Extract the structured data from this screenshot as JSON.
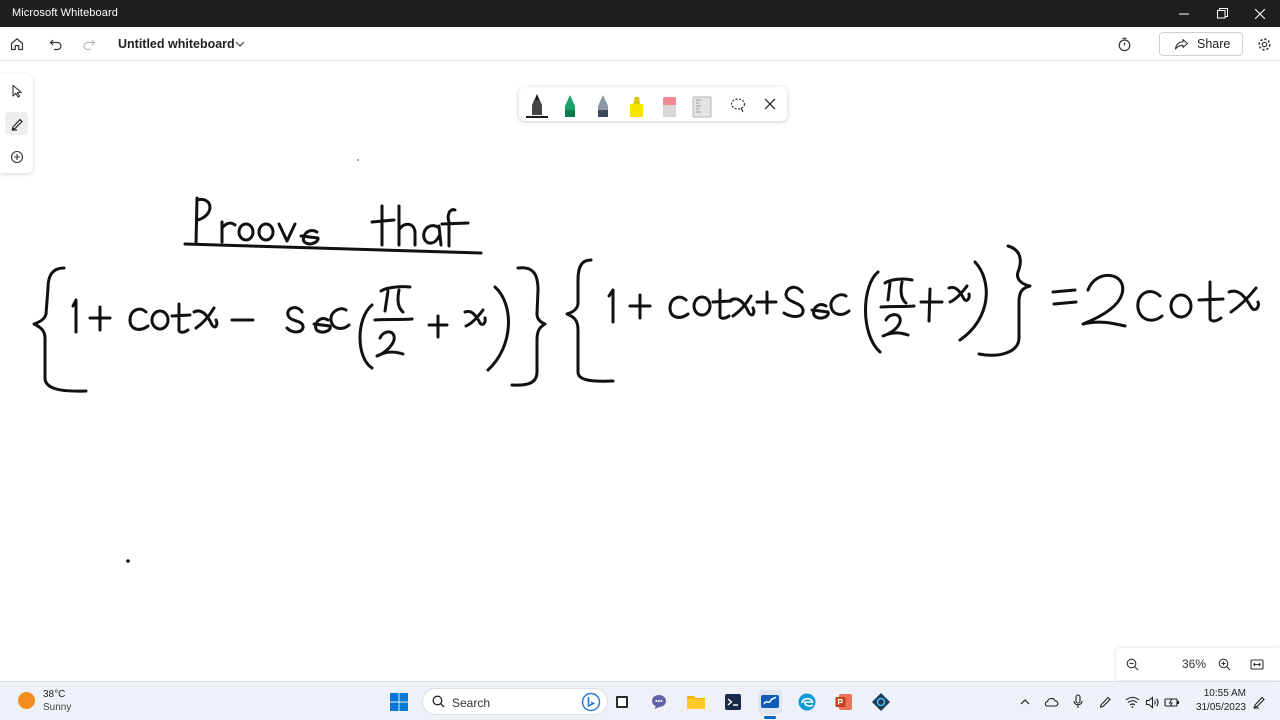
{
  "window": {
    "title": "Microsoft Whiteboard"
  },
  "appbar": {
    "board_title": "Untitled whiteboard",
    "share_label": "Share"
  },
  "zoom": {
    "level": "36%"
  },
  "taskbar": {
    "weather_temp": "38°C",
    "weather_condition": "Sunny",
    "search_label": "Search",
    "clock_time": "10:55 AM",
    "clock_date": "31/05/2023"
  },
  "pens": [
    {
      "name": "black-pen",
      "color": "#1a1a1a"
    },
    {
      "name": "green-pen",
      "color": "#1aa36a"
    },
    {
      "name": "gray-pen",
      "color": "#3b4a5c"
    },
    {
      "name": "highlighter",
      "color": "#f5e400"
    },
    {
      "name": "eraser",
      "color": "#f08a95"
    },
    {
      "name": "ruler",
      "color": "#cfcfcf"
    }
  ],
  "colors": {
    "accent": "#0067c0",
    "titlebar": "#1f1f1f",
    "taskbar": "#eef1f7"
  }
}
